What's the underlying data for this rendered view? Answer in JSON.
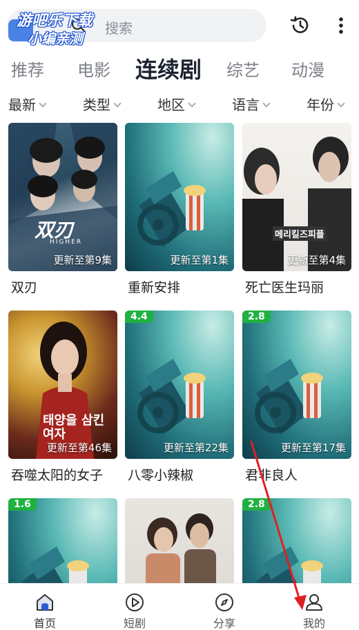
{
  "watermark": {
    "line1": "游吧乐下载",
    "line2": "小编亲测"
  },
  "search": {
    "placeholder": "搜索",
    "icon": "search-icon"
  },
  "header_icons": {
    "history": "history-icon",
    "more": "more-vert-icon"
  },
  "tabs": [
    {
      "label": "推荐"
    },
    {
      "label": "电影"
    },
    {
      "label": "连续剧",
      "active": true
    },
    {
      "label": "综艺"
    },
    {
      "label": "动漫"
    }
  ],
  "filters": [
    {
      "label": "最新"
    },
    {
      "label": "类型"
    },
    {
      "label": "地区"
    },
    {
      "label": "语言"
    },
    {
      "label": "年份"
    }
  ],
  "cards": [
    {
      "title": "双刃",
      "episode": "更新至第9集",
      "rating": ""
    },
    {
      "title": "重新安排",
      "episode": "更新至第1集",
      "rating": ""
    },
    {
      "title": "死亡医生玛丽",
      "episode": "更新至第4集",
      "rating": ""
    },
    {
      "title": "吞噬太阳的女子",
      "episode": "更新至第46集",
      "rating": ""
    },
    {
      "title": "八零小辣椒",
      "episode": "更新至第22集",
      "rating": "4.4"
    },
    {
      "title": "君非良人",
      "episode": "更新至第17集",
      "rating": "2.8"
    },
    {
      "title": "",
      "episode": "",
      "rating": "1.6"
    },
    {
      "title": "",
      "episode": "",
      "rating": ""
    },
    {
      "title": "",
      "episode": "",
      "rating": "2.8"
    }
  ],
  "poster_text": {
    "p1_logo": "双刃",
    "p1_sub": "HIGHER",
    "p3_title": "메리킬즈피플",
    "p4_title": "태양을 삼킨여자"
  },
  "bottom_nav": [
    {
      "label": "首页",
      "icon": "home-icon",
      "active": true
    },
    {
      "label": "短剧",
      "icon": "play-circle-icon"
    },
    {
      "label": "分享",
      "icon": "compass-icon"
    },
    {
      "label": "我的",
      "icon": "user-icon"
    }
  ],
  "colors": {
    "accent": "#1d2431",
    "rating_badge": "#1fb141",
    "annotation_arrow": "#e02020"
  }
}
